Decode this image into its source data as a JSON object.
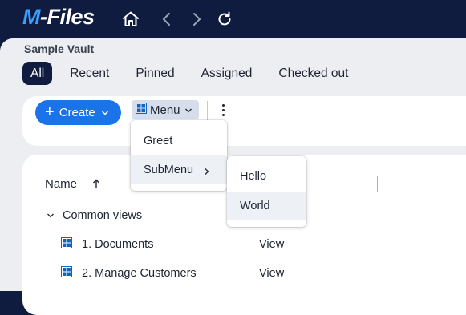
{
  "app": {
    "logo_prefix": "M",
    "logo_suffix": "-Files"
  },
  "nav": {
    "home": "home-icon",
    "back": "chevron-left-icon",
    "forward": "chevron-right-icon",
    "refresh": "refresh-icon"
  },
  "vault": {
    "name": "Sample Vault"
  },
  "tabs": [
    {
      "label": "All",
      "active": true
    },
    {
      "label": "Recent"
    },
    {
      "label": "Pinned"
    },
    {
      "label": "Assigned"
    },
    {
      "label": "Checked out"
    }
  ],
  "toolbar": {
    "create_label": "Create",
    "menu_label": "Menu"
  },
  "menu": {
    "items": [
      "Greet",
      "SubMenu"
    ]
  },
  "submenu": {
    "items": [
      "Hello",
      "World"
    ]
  },
  "list": {
    "column_name": "Name",
    "group_label": "Common views",
    "rows": [
      {
        "name": "1. Documents",
        "type": "View"
      },
      {
        "name": "2. Manage Customers",
        "type": "View"
      }
    ]
  },
  "colors": {
    "header_bg": "#0f1c3f",
    "accent": "#1a73e8",
    "content_bg": "#eceef2",
    "menu_btn_bg": "#d5deea",
    "icon_blue": "#1565c0"
  }
}
